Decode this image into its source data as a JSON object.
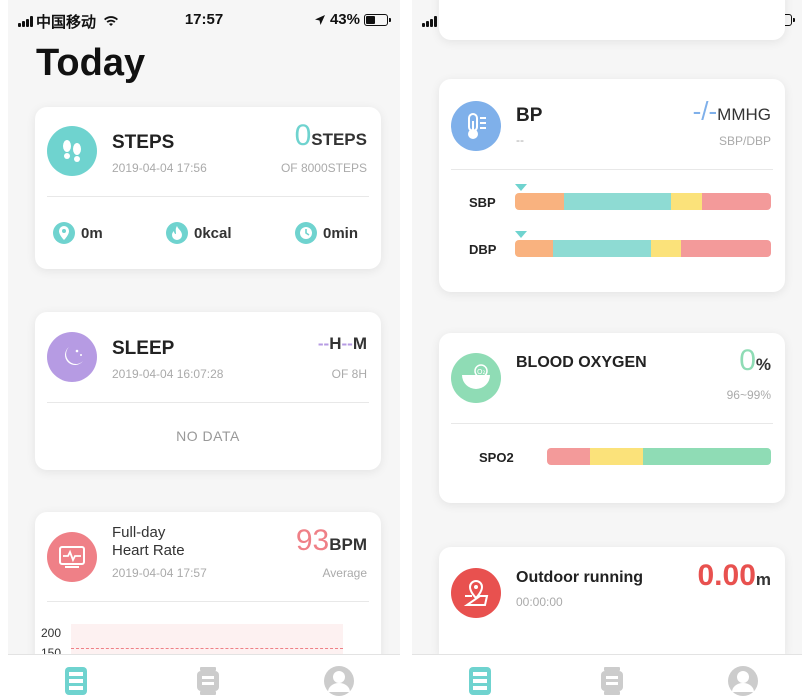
{
  "status": {
    "carrier": "中国移动",
    "time": "17:57",
    "battery": "43%"
  },
  "left": {
    "title": "Today",
    "steps": {
      "title": "STEPS",
      "timestamp": "2019-04-04 17:56",
      "value": "0",
      "unit": "STEPS",
      "goal": "OF 8000STEPS",
      "distance": "0m",
      "calories": "0kcal",
      "duration": "0min"
    },
    "sleep": {
      "title": "SLEEP",
      "timestamp": "2019-04-04 16:07:28",
      "hours": "--",
      "h_unit": "H",
      "minutes": "--",
      "m_unit": "M",
      "goal": "OF 8H",
      "empty": "NO DATA"
    },
    "heart": {
      "title_line1": "Full-day",
      "title_line2": "Heart Rate",
      "timestamp": "2019-04-04 17:57",
      "value": "93",
      "unit": "BPM",
      "sub": "Average",
      "y_top": "200",
      "y_second": "150"
    }
  },
  "right": {
    "bp": {
      "title": "BP",
      "sub": "--",
      "value": "-/-",
      "unit": "MMHG",
      "right_sub": "SBP/DBP",
      "sbp_label": "SBP",
      "dbp_label": "DBP"
    },
    "oxygen": {
      "title": "BLOOD OXYGEN",
      "value": "0",
      "unit": "%",
      "range": "96~99%",
      "spo2_label": "SPO2",
      "icon_text": "O₂"
    },
    "running": {
      "title": "Outdoor running",
      "duration": "00:00:00",
      "value": "0.00",
      "unit": "m"
    }
  },
  "colors": {
    "teal": "#6fd3cf",
    "purple": "#b69be3",
    "pink": "#ef8087",
    "blue": "#7fb0ea",
    "green": "#8fdcb5",
    "red": "#e8514f",
    "orange": "#f9b27f",
    "yellow": "#fbe27a"
  },
  "icons": [
    "footprints-icon",
    "location-icon",
    "flame-icon",
    "clock-icon",
    "moon-icon",
    "heart-monitor-icon",
    "thermometer-icon",
    "oxygen-icon",
    "map-pin-icon",
    "today-tab-icon",
    "device-tab-icon",
    "profile-tab-icon"
  ]
}
